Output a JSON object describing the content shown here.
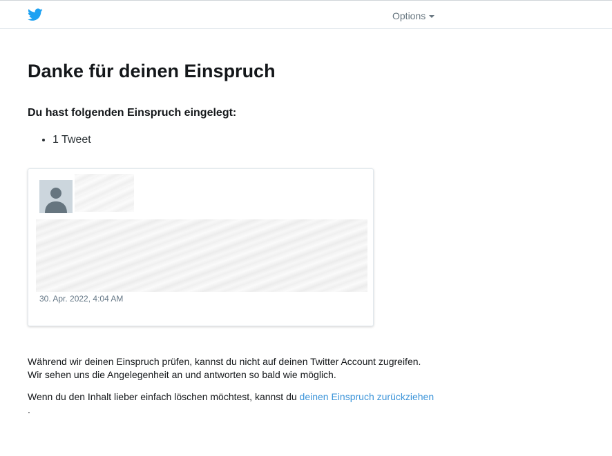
{
  "header": {
    "logo_icon": "twitter-bird-icon",
    "brand_color": "#1da1f2",
    "options_label": "Options"
  },
  "main": {
    "title": "Danke für deinen Einspruch",
    "subtitle": "Du hast folgenden Einspruch eingelegt:",
    "appeal_items": [
      "1 Tweet"
    ],
    "tweet": {
      "avatar_icon": "default-avatar-icon",
      "date": "30. Apr. 2022, 4:04 AM"
    },
    "info_line1": "Während wir deinen Einspruch prüfen, kannst du nicht auf deinen Twitter Account zugreifen.",
    "info_line2": "Wir sehen uns die Angelegenheit an und antworten so bald wie möglich.",
    "delete_text": "Wenn du den Inhalt lieber einfach löschen möchtest, kannst du",
    "withdraw_link": "deinen Einspruch zurückziehen",
    "trailing_dot": ".",
    "link_color": "#3b94d9"
  }
}
